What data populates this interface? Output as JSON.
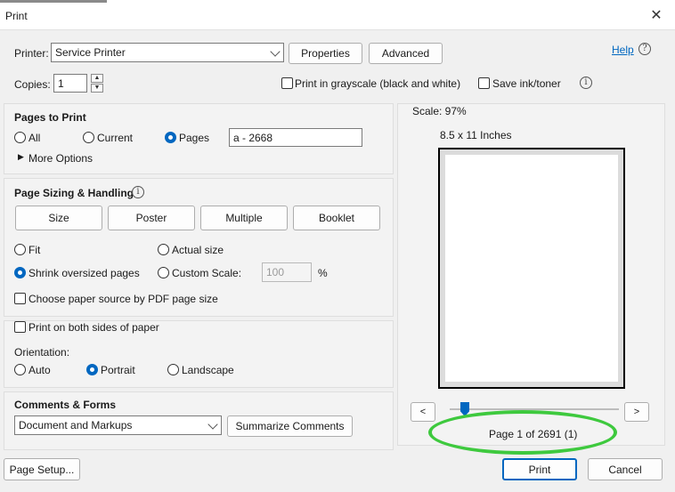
{
  "window": {
    "title": "Print",
    "close_icon": "close-icon"
  },
  "header": {
    "printer_label": "Printer:",
    "printer_value": "Service Printer",
    "properties_label": "Properties",
    "advanced_label": "Advanced",
    "help_label": "Help",
    "copies_label": "Copies:",
    "copies_value": "1",
    "grayscale_label": "Print in grayscale (black and white)",
    "save_ink_label": "Save ink/toner"
  },
  "pages_to_print": {
    "title": "Pages to Print",
    "all_label": "All",
    "current_label": "Current",
    "pages_label": "Pages",
    "pages_value": "a - 2668",
    "selected": "Pages",
    "more_options_label": "More Options"
  },
  "sizing": {
    "title": "Page Sizing & Handling",
    "tabs": [
      "Size",
      "Poster",
      "Multiple",
      "Booklet"
    ],
    "fit_label": "Fit",
    "actual_size_label": "Actual size",
    "shrink_label": "Shrink oversized pages",
    "custom_scale_label": "Custom Scale:",
    "custom_scale_value": "100",
    "percent_label": "%",
    "selected": "Shrink oversized pages",
    "paper_source_label": "Choose paper source by PDF page size"
  },
  "duplex": {
    "both_sides_label": "Print on both sides of paper",
    "orientation_label": "Orientation:",
    "auto_label": "Auto",
    "portrait_label": "Portrait",
    "landscape_label": "Landscape",
    "selected": "Portrait"
  },
  "comments": {
    "title": "Comments & Forms",
    "select_value": "Document and Markups",
    "summarize_label": "Summarize Comments"
  },
  "preview": {
    "scale_text": "Scale:  97%",
    "size_text": "8.5 x 11 Inches",
    "prev_label": "<",
    "next_label": ">",
    "page_info": "Page 1 of 2691 (1)",
    "slider_fraction": 0.0,
    "highlight_color": "#3ec93e"
  },
  "footer": {
    "page_setup_label": "Page Setup...",
    "print_label": "Print",
    "cancel_label": "Cancel"
  }
}
